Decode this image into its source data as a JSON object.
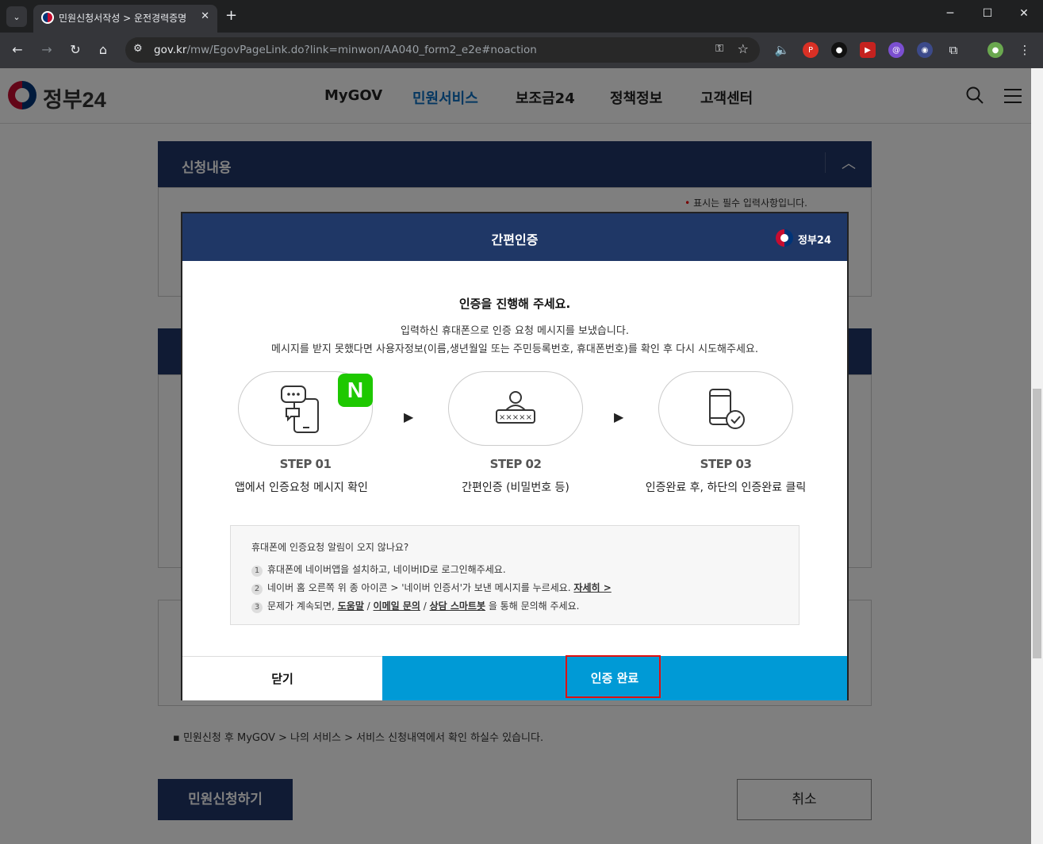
{
  "browser": {
    "tab_title": "민원신청서작성 > 운전경력증명",
    "url_host": "gov.kr",
    "url_path": "/mw/EgovPageLink.do?link=minwon/AA040_form2_e2e#noaction",
    "new_tab": "+",
    "minimize": "─",
    "maximize": "☐",
    "close": "✕"
  },
  "site": {
    "logo_text": "정부24",
    "nav": [
      "MyGOV",
      "민원서비스",
      "보조금24",
      "정책정보",
      "고객센터"
    ],
    "active_nav": "민원서비스"
  },
  "page": {
    "section_title": "신청내용",
    "required_note": "표시는 필수 입력사항입니다.",
    "footnote": "민원신청 후 MyGOV > 나의 서비스 > 서비스 신청내역에서 확인 하실수 있습니다.",
    "submit_label": "민원신청하기",
    "cancel_label": "취소"
  },
  "modal": {
    "title": "간편인증",
    "logo_text": "정부24",
    "heading": "인증을 진행해 주세요.",
    "desc_line1": "입력하신 휴대폰으로 인증 요청 메시지를 보냈습니다.",
    "desc_line2": "메시지를 받지 못했다면 사용자정보(이름,생년월일 또는 주민등록번호, 휴대폰번호)를 확인 후 다시 시도해주세요.",
    "steps": [
      {
        "title": "STEP 01",
        "desc": "앱에서 인증요청 메시지 확인",
        "icon": "phone-message-icon"
      },
      {
        "title": "STEP 02",
        "desc": "간편인증 (비밀번호 등)",
        "icon": "user-password-icon"
      },
      {
        "title": "STEP 03",
        "desc": "인증완료 후, 하단의 인증완료 클릭",
        "icon": "phone-check-icon"
      }
    ],
    "arrow": "▶",
    "naver_badge": "N",
    "help": {
      "question": "휴대폰에 인증요청 알림이 오지 않나요?",
      "item1": "휴대폰에 네이버앱을 설치하고, 네이버ID로 로그인해주세요.",
      "item2_pre": "네이버 홈 오른쪽 위 종 아이콘 > '네이버 인증서'가 보낸 메시지를 누르세요. ",
      "item2_link": "자세히 >",
      "item3_pre": "문제가 계속되면, ",
      "item3_link1": "도움말",
      "item3_sep1": " / ",
      "item3_link2": "이메일 문의",
      "item3_sep2": " / ",
      "item3_link3": "상담 스마트봇",
      "item3_post": " 을 통해 문의해 주세요."
    },
    "close_label": "닫기",
    "confirm_label": "인증 완료"
  },
  "colors": {
    "modal_header": "#1f3766",
    "confirm_button": "#009ad6",
    "highlight": "#e01010",
    "active_nav": "#0a6fc2"
  }
}
